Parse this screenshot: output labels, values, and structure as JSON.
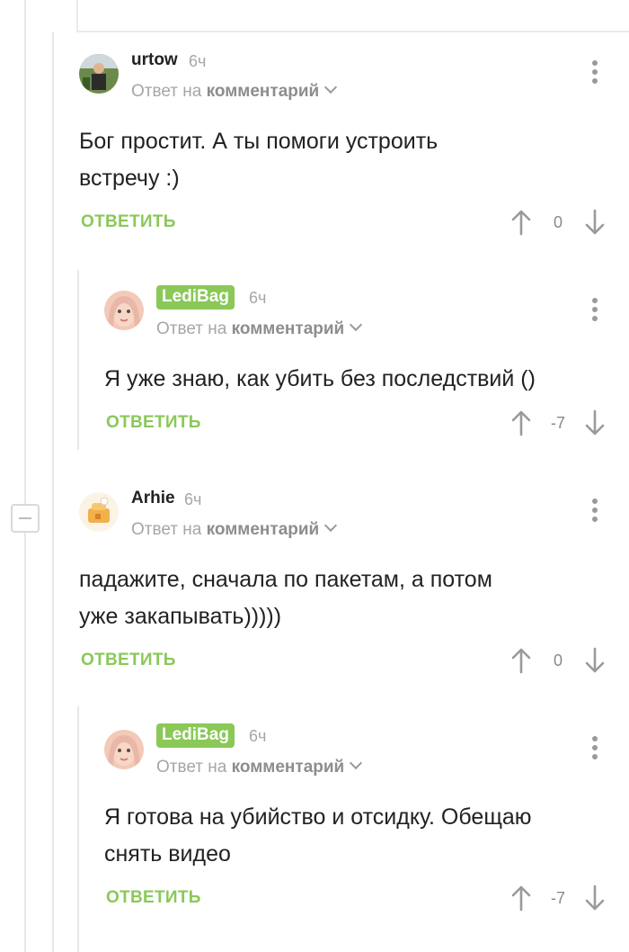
{
  "comments": [
    {
      "username": "urtow",
      "time": "6ч",
      "reply_prefix": "Ответ на",
      "reply_target": "комментарий",
      "text_lines": [
        "Бог простит. А ты помоги устроить",
        "встречу :)"
      ],
      "reply_label": "ОТВЕТИТЬ",
      "rating": "0"
    },
    {
      "username": "LediBag",
      "time": "6ч",
      "reply_prefix": "Ответ на",
      "reply_target": "комментарий",
      "text_lines": [
        "Я уже знаю, как убить без последствий ()"
      ],
      "reply_label": "ОТВЕТИТЬ",
      "rating": "-7"
    },
    {
      "username": "Arhie",
      "time": "6ч",
      "reply_prefix": "Ответ на",
      "reply_target": "комментарий",
      "text_lines": [
        "падажите, сначала по пакетам, а потом",
        "уже закапывать)))))"
      ],
      "reply_label": "ОТВЕТИТЬ",
      "rating": "0"
    },
    {
      "username": "LediBag",
      "time": "6ч",
      "reply_prefix": "Ответ на",
      "reply_target": "комментарий",
      "text_lines": [
        "Я готова на убийство и отсидку. Обещаю",
        "снять видео"
      ],
      "reply_label": "ОТВЕТИТЬ",
      "rating": "-7"
    }
  ],
  "colors": {
    "accent_green": "#8ac858",
    "muted_text": "#a6a6a6",
    "thread_line": "#e7e7e7"
  },
  "icons": {
    "upvote": "arrow-up-icon",
    "downvote": "arrow-down-icon",
    "menu": "more-vertical-icon",
    "collapse": "minus-icon",
    "dropdown": "chevron-down-icon"
  }
}
